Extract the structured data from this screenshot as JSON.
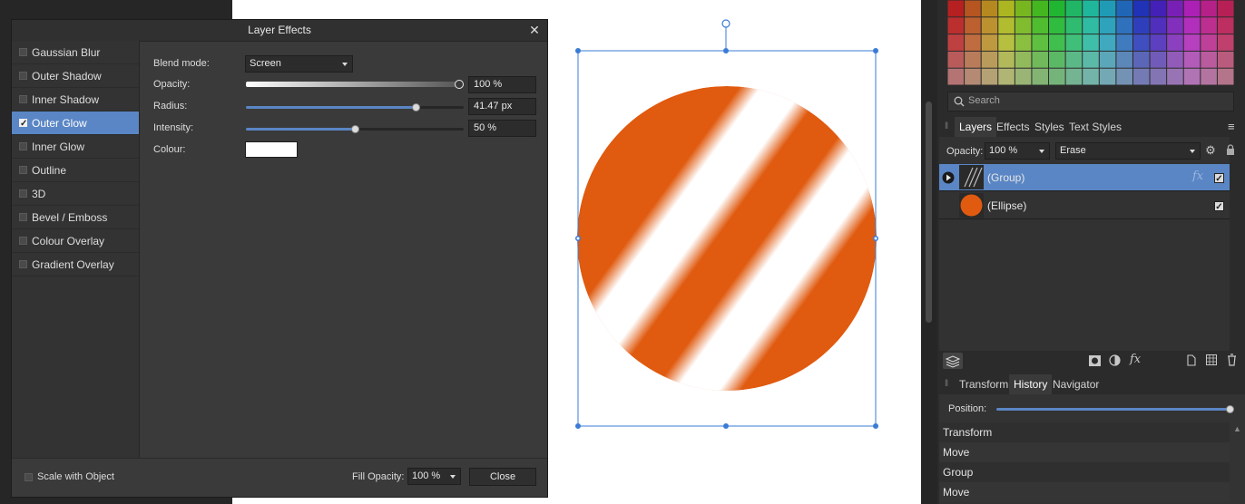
{
  "dialog": {
    "title": "Layer Effects",
    "close_glyph": "✕",
    "effects": [
      {
        "label": "Gaussian Blur",
        "checked": false,
        "selected": false
      },
      {
        "label": "Outer Shadow",
        "checked": false,
        "selected": false
      },
      {
        "label": "Inner Shadow",
        "checked": false,
        "selected": false
      },
      {
        "label": "Outer Glow",
        "checked": true,
        "selected": true
      },
      {
        "label": "Inner Glow",
        "checked": false,
        "selected": false
      },
      {
        "label": "Outline",
        "checked": false,
        "selected": false
      },
      {
        "label": "3D",
        "checked": false,
        "selected": false
      },
      {
        "label": "Bevel / Emboss",
        "checked": false,
        "selected": false
      },
      {
        "label": "Colour Overlay",
        "checked": false,
        "selected": false
      },
      {
        "label": "Gradient Overlay",
        "checked": false,
        "selected": false
      }
    ],
    "props": {
      "blend_label": "Blend mode:",
      "blend_value": "Screen",
      "opacity_label": "Opacity:",
      "opacity_value": "100 %",
      "opacity_fraction": 1.0,
      "radius_label": "Radius:",
      "radius_value": "41.47 px",
      "radius_fraction": 0.78,
      "intensity_label": "Intensity:",
      "intensity_value": "50 %",
      "intensity_fraction": 0.5,
      "colour_label": "Colour:",
      "colour_swatch": "#ffffff"
    },
    "footer": {
      "scale_label": "Scale with Object",
      "fill_opacity_label": "Fill Opacity:",
      "fill_opacity_value": "100 %",
      "close_label": "Close"
    }
  },
  "canvas": {
    "shape_color": "#e05a0f",
    "selection_color": "#3a7bd5"
  },
  "right_panel": {
    "search_placeholder": "Search",
    "tabs": [
      "Layers",
      "Effects",
      "Styles",
      "Text Styles"
    ],
    "active_tab": "Layers",
    "opacity_label": "Opacity:",
    "opacity_value": "100 %",
    "blend_value": "Erase",
    "layers": [
      {
        "name": "(Group)",
        "selected": true,
        "fx": "fx",
        "visible": true
      },
      {
        "name": "(Ellipse)",
        "selected": false,
        "visible": true
      }
    ],
    "bottom_tabs": [
      "Transform",
      "History",
      "Navigator"
    ],
    "active_bottom_tab": "History",
    "position_label": "Position:",
    "position_fraction": 1.0,
    "history": [
      "Transform",
      "Move",
      "Group",
      "Move"
    ],
    "accent": "#5a86c5",
    "icons": {
      "layers_stack": "layers-stack-icon",
      "mask": "mask-icon",
      "adjust": "adjustment-icon",
      "fx": "fx-icon",
      "add_page": "add-layer-icon",
      "grid": "grid-icon",
      "trash": "trash-icon",
      "gear": "gear-icon",
      "lock": "lock-icon",
      "menu": "menu-icon"
    }
  }
}
